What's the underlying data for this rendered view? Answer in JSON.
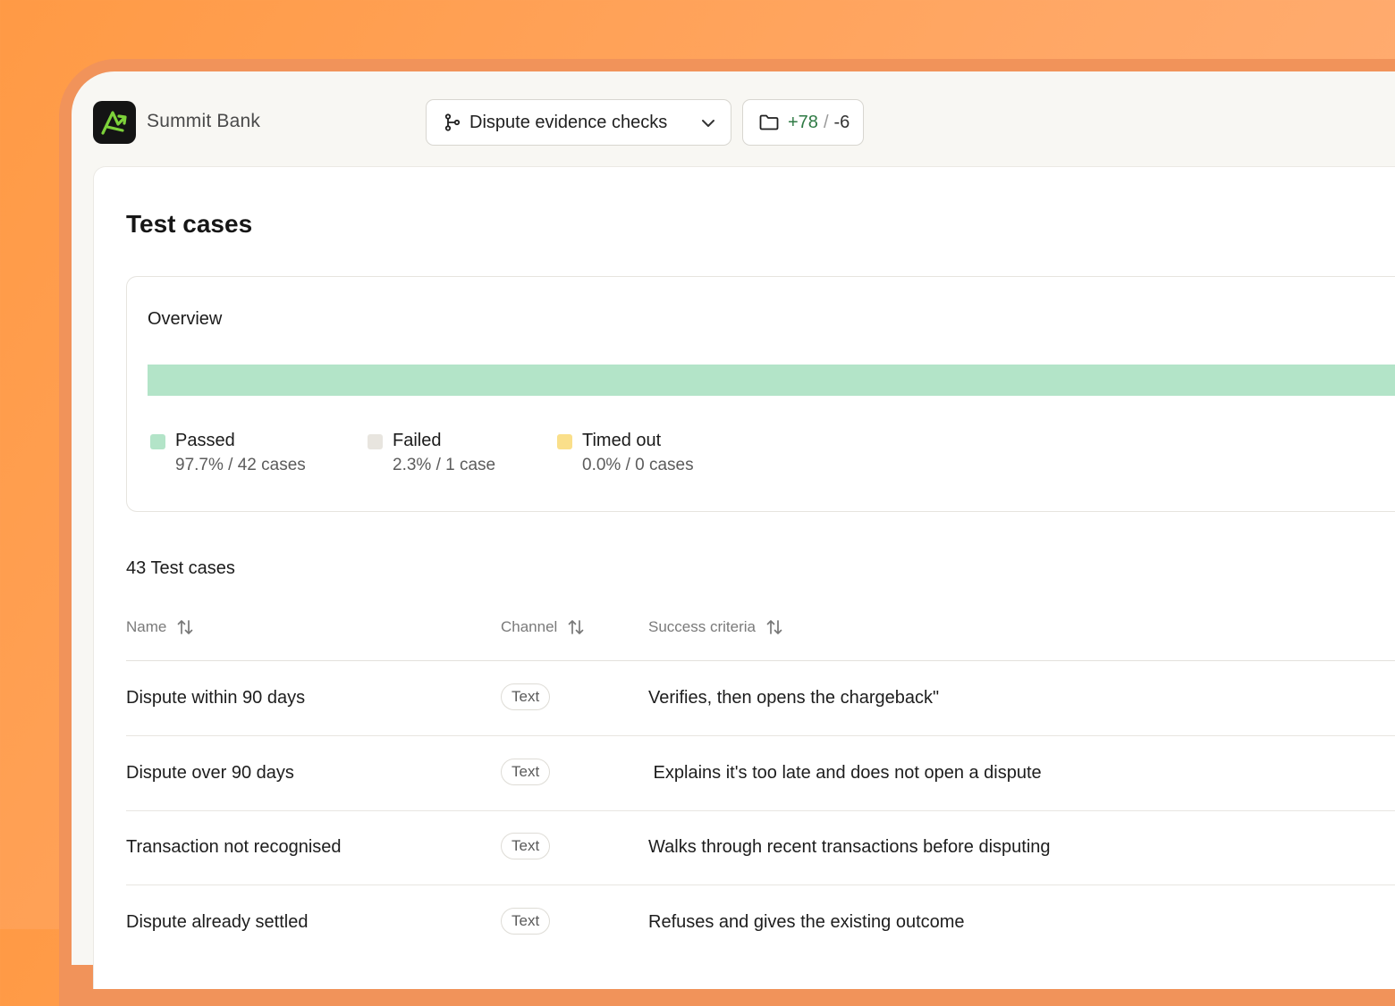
{
  "app": {
    "brand": "Summit Bank"
  },
  "toolbar": {
    "branch_label": "Dispute evidence checks",
    "diff_added": "+78",
    "diff_sep": "/",
    "diff_removed": "-6"
  },
  "page": {
    "title": "Test cases"
  },
  "overview": {
    "title": "Overview",
    "pass_fraction": 0.977,
    "legend": [
      {
        "label": "Passed",
        "stat": "97.7% / 42 cases",
        "color": "#b3e4c8"
      },
      {
        "label": "Failed",
        "stat": "2.3% / 1 case",
        "color": "#e8e5df"
      },
      {
        "label": "Timed out",
        "stat": "0.0% / 0 cases",
        "color": "#fadf8a"
      }
    ]
  },
  "table": {
    "count_label": "43 Test cases",
    "columns": [
      "Name",
      "Channel",
      "Success criteria"
    ],
    "rows": [
      {
        "name": "Dispute within 90 days",
        "channel": "Text",
        "criteria": "Verifies, then opens the chargeback\""
      },
      {
        "name": "Dispute over 90 days",
        "channel": "Text",
        "criteria": " Explains it's too late and does not open a dispute"
      },
      {
        "name": "Transaction not recognised",
        "channel": "Text",
        "criteria": "Walks through recent transactions before disputing"
      },
      {
        "name": "Dispute already settled",
        "channel": "Text",
        "criteria": "Refuses and gives the existing outcome"
      }
    ]
  },
  "colors": {
    "accent_green": "#2e7a44",
    "logo_bg": "#141414",
    "logo_mark": "#7dd23a"
  }
}
